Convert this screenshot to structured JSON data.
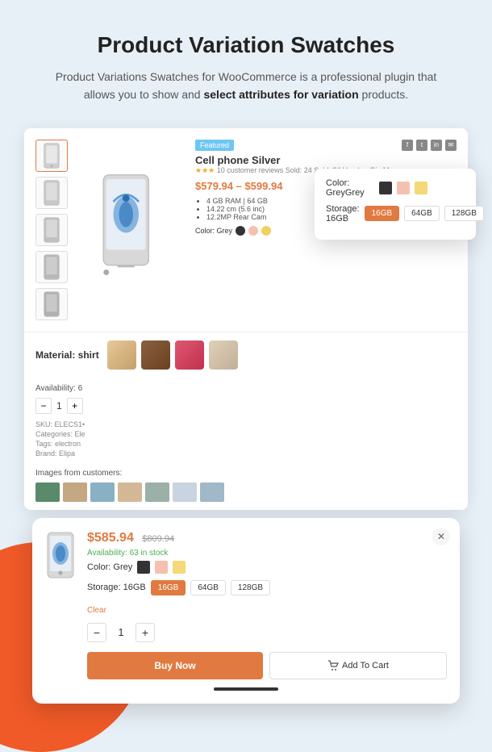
{
  "header": {
    "title": "Product Variation Swatches",
    "description_start": "Product Variations Swatches for WooCommerce is a professional plugin that allows you to show and ",
    "description_bold": "select attributes for variation",
    "description_end": " products."
  },
  "product": {
    "featured_badge": "Featured",
    "title": "Cell phone Silver",
    "reviews": "10 customer reviews",
    "sold": "Sold: 24",
    "vendor": "Vendor: Gia Marquez",
    "price_range": "$579.94 – $599.94",
    "specs": [
      "4 GB RAM | 64 GB",
      "14.22 cm (5.6 inc)",
      "12.2MP Rear Cam"
    ],
    "color_label": "Color: Grey",
    "availability_label": "Availability:",
    "availability_count": "6",
    "qty": "1",
    "sku": "SKU: ELECS1•",
    "categories": "Categories: Ele",
    "tags": "Tags: electron",
    "brand": "Brand: Elipa"
  },
  "color_popup": {
    "color_label": "Color:",
    "color_name": "Grey",
    "colors": [
      "#333333",
      "#f5c0b0",
      "#f5d878"
    ],
    "storage_label": "Storage:",
    "storage_value": "16GB",
    "storage_options": [
      "16GB",
      "64GB",
      "128GB"
    ]
  },
  "material_section": {
    "label": "Material: shirt"
  },
  "mobile_popup": {
    "price": "$585.94",
    "old_price": "$809.94",
    "availability_label": "Availability:",
    "availability_value": "63 in stock",
    "color_label": "Color:",
    "color_name": "Grey",
    "colors": [
      "#333333",
      "#f5c0b0",
      "#f5d878"
    ],
    "storage_label": "Storage:",
    "storage_value": "16GB",
    "storage_options": [
      "16GB",
      "64GB",
      "128GB"
    ],
    "clear_label": "Clear",
    "qty": "1",
    "buy_now_label": "Buy Now",
    "add_to_cart_label": "Add To Cart"
  },
  "customer_images": {
    "label": "Images from customers:"
  }
}
